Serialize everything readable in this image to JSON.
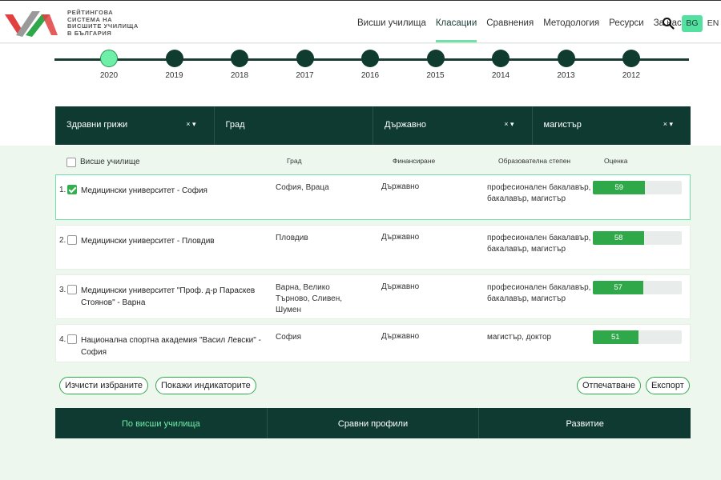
{
  "brand": {
    "logo_lines": [
      "Рейтингова",
      "система на",
      "висшите училища",
      "в България"
    ],
    "accent": "#53e0a0",
    "dark": "#0e3a31",
    "logo_red": "#e04040",
    "logo_green": "#2fa84a",
    "logo_gray": "#9a9a9a"
  },
  "nav": {
    "items": [
      "Висши училища",
      "Класации",
      "Сравнения",
      "Методология",
      "Ресурси",
      "За нас"
    ],
    "active_index": 1,
    "search_icon": "search-icon",
    "languages": [
      "BG",
      "EN"
    ],
    "active_language": "BG"
  },
  "timeline": {
    "years": [
      "2020",
      "2019",
      "2018",
      "2017",
      "2016",
      "2015",
      "2014",
      "2013",
      "2012"
    ],
    "active_year": "2020"
  },
  "filters": [
    {
      "label": "Здравни грижи",
      "clear": "×",
      "arrow": "▾"
    },
    {
      "label": "Град",
      "clear": "",
      "arrow": ""
    },
    {
      "label": "Държавно",
      "clear": "×",
      "arrow": "▾"
    },
    {
      "label": "магистър",
      "clear": "×",
      "arrow": "▾"
    }
  ],
  "table": {
    "headers": {
      "university": "Висше училище",
      "city": "Град",
      "funding": "Финансиране",
      "degree": "Образователна степен",
      "score": "Оценка"
    },
    "score_max": 100,
    "rows": [
      {
        "rank": "1.",
        "checked": true,
        "name": "Медицински университет - София",
        "city": "София, Враца",
        "funding": "Държавно",
        "degree": "професионален бакалавър, бакалавър, магистър",
        "score": 59
      },
      {
        "rank": "2.",
        "checked": false,
        "name": "Медицински университет - Пловдив",
        "city": "Пловдив",
        "funding": "Държавно",
        "degree": "професионален бакалавър, бакалавър, магистър",
        "score": 58
      },
      {
        "rank": "3.",
        "checked": false,
        "name": "Медицински университет \"Проф. д-р Параскев Стоянов\" - Варна",
        "city": "Варна, Велико Търново, Сливен, Шумен",
        "funding": "Държавно",
        "degree": "професионален бакалавър, бакалавър, магистър",
        "score": 57
      },
      {
        "rank": "4.",
        "checked": false,
        "name": "Национална спортна академия \"Васил Левски\" - София",
        "city": "София",
        "funding": "Държавно",
        "degree": "магистър, доктор",
        "score": 51
      }
    ]
  },
  "actions": {
    "clear_selected": "Изчисти избраните",
    "show_indicators": "Покажи индикаторите",
    "print": "Отпечатване",
    "export": "Експорт"
  },
  "bottom_tabs": {
    "items": [
      "По висши училища",
      "Сравни профили",
      "Развитие"
    ],
    "active_index": 0
  }
}
